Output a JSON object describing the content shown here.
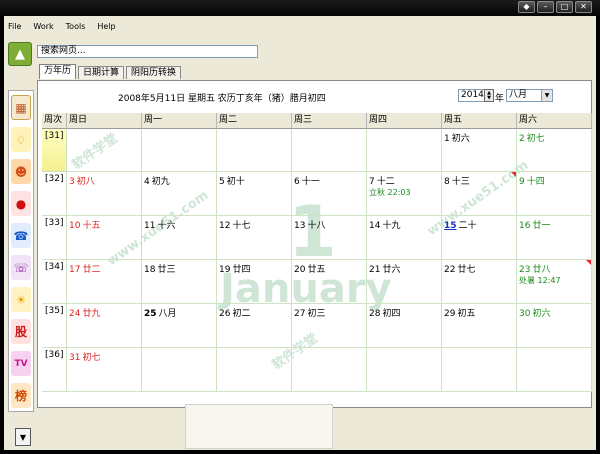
{
  "window": {
    "buttons": [
      "◆",
      "–",
      "□",
      "✕"
    ]
  },
  "menu": [
    "File",
    "Work",
    "Tools",
    "Help"
  ],
  "search": {
    "placeholder": "搜索网页..."
  },
  "tabs": [
    "万年历",
    "日期计算",
    "阴阳历转换"
  ],
  "panel": {
    "title": "2008年5月11日 星期五 农历丁亥年（猪）腊月初四",
    "year": "2014",
    "year_unit": "年",
    "month": "八月"
  },
  "calendar": {
    "headers": [
      "周次",
      "周日",
      "周一",
      "周二",
      "周三",
      "周四",
      "周五",
      "周六"
    ],
    "weeks": [
      {
        "label": "[31]",
        "current": true,
        "days": [
          null,
          null,
          null,
          null,
          null,
          {
            "d": "1",
            "l": "初六",
            "c": "#000"
          },
          {
            "d": "2",
            "l": "初七",
            "c": "#1a8a1a"
          }
        ]
      },
      {
        "label": "[32]",
        "days": [
          {
            "d": "3",
            "l": "初八",
            "c": "#d22"
          },
          {
            "d": "4",
            "l": "初九",
            "c": "#000"
          },
          {
            "d": "5",
            "l": "初十",
            "c": "#000"
          },
          {
            "d": "6",
            "l": "十一",
            "c": "#000"
          },
          {
            "d": "7",
            "l": "十二",
            "c": "#000",
            "sub": "立秋 22:03"
          },
          {
            "d": "8",
            "l": "十三",
            "c": "#000",
            "mark": true
          },
          {
            "d": "9",
            "l": "十四",
            "c": "#1a8a1a"
          }
        ]
      },
      {
        "label": "[33]",
        "days": [
          {
            "d": "10",
            "l": "十五",
            "c": "#d22"
          },
          {
            "d": "11",
            "l": "十六",
            "c": "#000"
          },
          {
            "d": "12",
            "l": "十七",
            "c": "#000"
          },
          {
            "d": "13",
            "l": "十八",
            "c": "#000"
          },
          {
            "d": "14",
            "l": "十九",
            "c": "#000"
          },
          {
            "d": "15",
            "l": "二十",
            "c": "#1533c4",
            "bold": true,
            "underline": true
          },
          {
            "d": "16",
            "l": "廿一",
            "c": "#1a8a1a"
          }
        ]
      },
      {
        "label": "[34]",
        "days": [
          {
            "d": "17",
            "l": "廿二",
            "c": "#d22"
          },
          {
            "d": "18",
            "l": "廿三",
            "c": "#000"
          },
          {
            "d": "19",
            "l": "廿四",
            "c": "#000"
          },
          {
            "d": "20",
            "l": "廿五",
            "c": "#000"
          },
          {
            "d": "21",
            "l": "廿六",
            "c": "#000"
          },
          {
            "d": "22",
            "l": "廿七",
            "c": "#000"
          },
          {
            "d": "23",
            "l": "廿八",
            "c": "#1a8a1a",
            "sub": "处暑 12:47",
            "mark": true
          }
        ]
      },
      {
        "label": "[35]",
        "days": [
          {
            "d": "24",
            "l": "廿九",
            "c": "#d22"
          },
          {
            "d": "25",
            "l": "八月",
            "c": "#000",
            "bold": true
          },
          {
            "d": "26",
            "l": "初二",
            "c": "#000"
          },
          {
            "d": "27",
            "l": "初三",
            "c": "#000"
          },
          {
            "d": "28",
            "l": "初四",
            "c": "#000"
          },
          {
            "d": "29",
            "l": "初五",
            "c": "#000"
          },
          {
            "d": "30",
            "l": "初六",
            "c": "#1a8a1a"
          }
        ]
      },
      {
        "label": "[36]",
        "days": [
          {
            "d": "31",
            "l": "初七",
            "c": "#d22"
          },
          null,
          null,
          null,
          null,
          null,
          null
        ]
      }
    ]
  },
  "watermark": {
    "line1": "软件学堂",
    "line2": "www.xue51.com",
    "big": "January"
  },
  "toolbar_icons": [
    "calendar-icon",
    "bell-icon",
    "face-icon",
    "lantern-icon",
    "phone-icon",
    "contacts-icon",
    "weather-icon",
    "stock-icon",
    "tv-icon",
    "ranking-icon"
  ],
  "toolbar_labels": {
    "stock": "股",
    "tv": "TV",
    "rank": "榜"
  },
  "colors": {
    "sunday": "#d22",
    "saturday": "#1a8a1a",
    "today": "#1533c4",
    "accent": "#7fae37"
  }
}
